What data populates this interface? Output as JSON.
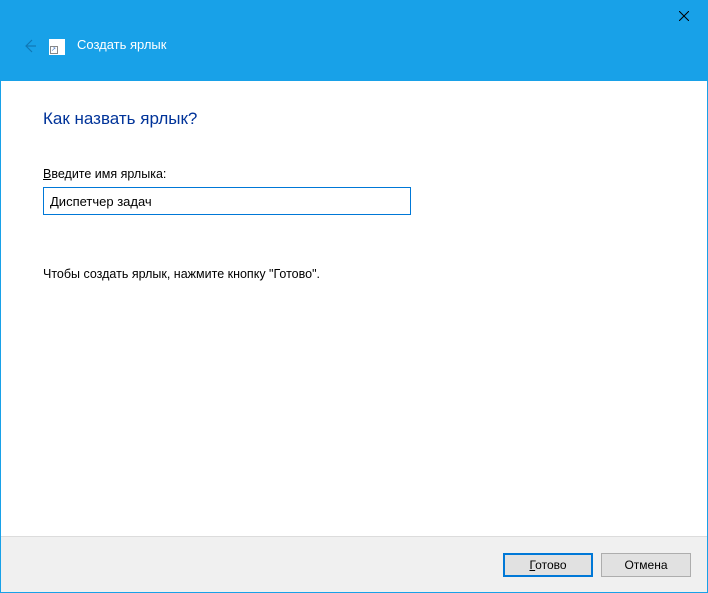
{
  "titlebar": {
    "wizard_title": "Создать ярлык"
  },
  "content": {
    "heading": "Как назвать ярлык?",
    "field_label_pre": "В",
    "field_label_rest": "ведите имя ярлыка:",
    "input_value": "Диспетчер задач",
    "hint": "Чтобы создать ярлык, нажмите кнопку \"Готово\"."
  },
  "footer": {
    "finish_underline": "Г",
    "finish_rest": "отово",
    "cancel": "Отмена"
  }
}
